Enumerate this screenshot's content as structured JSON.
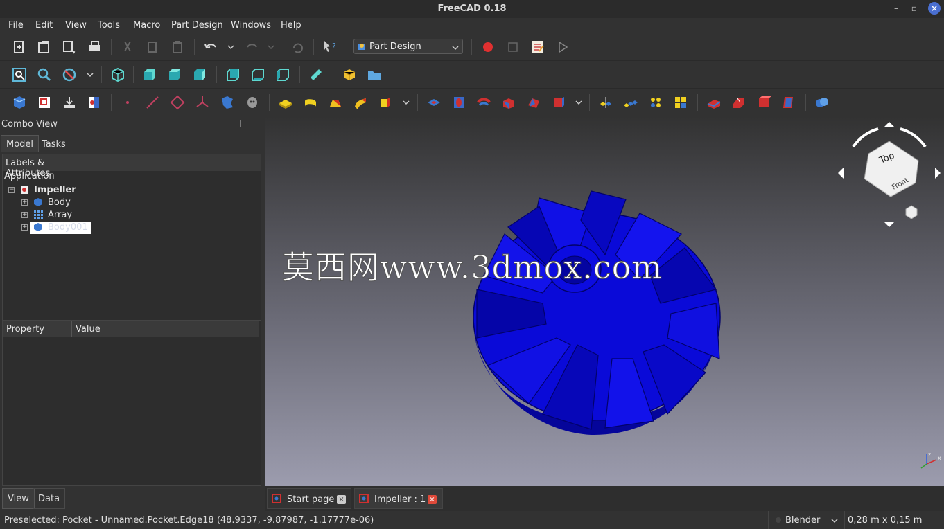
{
  "window": {
    "title": "FreeCAD 0.18"
  },
  "menu": [
    "File",
    "Edit",
    "View",
    "Tools",
    "Macro",
    "Part Design",
    "Windows",
    "Help"
  ],
  "workbench": {
    "selected": "Part Design"
  },
  "combo": {
    "title": "Combo View",
    "tabs": [
      "Model",
      "Tasks"
    ],
    "tree_header": "Labels & Attributes",
    "root_label": "Application",
    "document": "Impeller",
    "items": [
      "Body",
      "Array",
      "Body001"
    ],
    "prop_headers": [
      "Property",
      "Value"
    ],
    "bottom_tabs": [
      "View",
      "Data"
    ]
  },
  "watermark": "莫西网www.3dmox.com",
  "navcube": {
    "top": "Top",
    "front": "Front"
  },
  "doc_tabs": [
    "Start page",
    "Impeller : 1"
  ],
  "status": {
    "message": "Preselected: Pocket - Unnamed.Pocket.Edge18 (48.9337, -9.87987, -1.17777e-06)",
    "nav_style": "Blender",
    "dimensions": "0,28 m x 0,15 m"
  },
  "colors": {
    "part": "#0a0ad8",
    "accent_record": "#e03030",
    "tree_selection": "#ffffff"
  }
}
